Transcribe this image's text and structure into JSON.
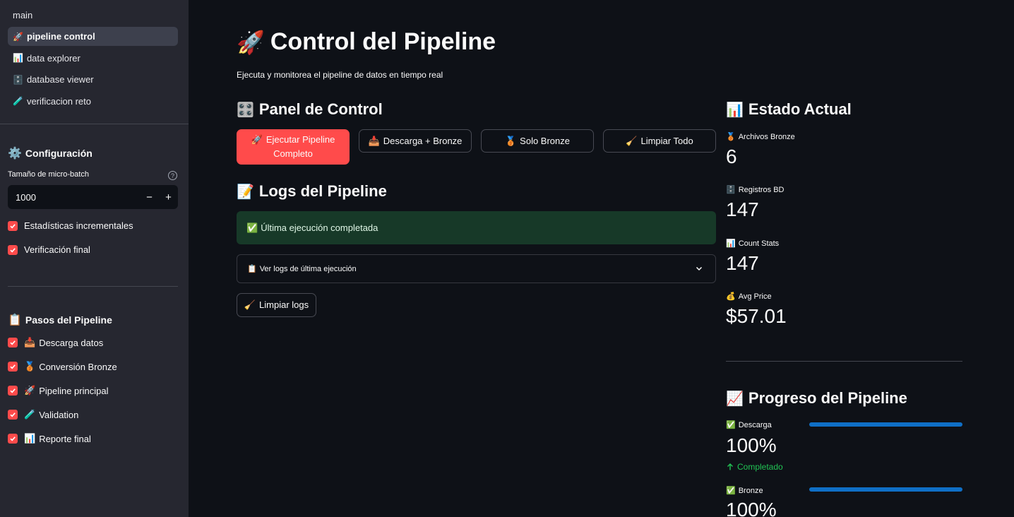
{
  "sidebar": {
    "nav": [
      {
        "icon": "",
        "label": "main"
      },
      {
        "icon": "🚀",
        "label": "pipeline control"
      },
      {
        "icon": "📊",
        "label": "data explorer"
      },
      {
        "icon": "🗄️",
        "label": "database viewer"
      },
      {
        "icon": "🧪",
        "label": "verificacion reto"
      }
    ],
    "config": {
      "icon": "⚙️",
      "title": "Configuración",
      "batch_label": "Tamaño de micro-batch",
      "batch_value": "1000",
      "help_icon": "?",
      "minus": "−",
      "plus": "+",
      "checkboxes": [
        {
          "label": "Estadísticas incrementales",
          "checked": true
        },
        {
          "label": "Verificación final",
          "checked": true
        }
      ]
    },
    "steps": {
      "icon": "📋",
      "title": "Pasos del Pipeline",
      "items": [
        {
          "icon": "📥",
          "label": "Descarga datos",
          "checked": true
        },
        {
          "icon": "🥉",
          "label": "Conversión Bronze",
          "checked": true
        },
        {
          "icon": "🚀",
          "label": "Pipeline principal",
          "checked": true
        },
        {
          "icon": "🧪",
          "label": "Validation",
          "checked": true
        },
        {
          "icon": "📊",
          "label": "Reporte final",
          "checked": true
        }
      ]
    }
  },
  "main": {
    "title_icon": "🚀",
    "title": "Control del Pipeline",
    "subtitle": "Ejecuta y monitorea el pipeline de datos en tiempo real",
    "control_panel": {
      "icon": "🎛️",
      "title": "Panel de Control",
      "buttons": [
        {
          "icon": "🚀",
          "label": "Ejecutar Pipeline Completo"
        },
        {
          "icon": "📥",
          "label": "Descarga + Bronze"
        },
        {
          "icon": "🥉",
          "label": "Solo Bronze"
        },
        {
          "icon": "🧹",
          "label": "Limpiar Todo"
        }
      ]
    },
    "logs": {
      "icon": "📝",
      "title": "Logs del Pipeline",
      "status_icon": "✅",
      "status": "Última ejecución completada",
      "expander_icon": "📋",
      "expander": "Ver logs de última ejecución",
      "clear_icon": "🧹",
      "clear": "Limpiar logs"
    },
    "state": {
      "icon": "📊",
      "title": "Estado Actual",
      "metrics": [
        {
          "icon": "🥉",
          "label": "Archivos Bronze",
          "value": "6"
        },
        {
          "icon": "🗄️",
          "label": "Registros BD",
          "value": "147"
        },
        {
          "icon": "📊",
          "label": "Count Stats",
          "value": "147"
        },
        {
          "icon": "💰",
          "label": "Avg Price",
          "value": "$57.01"
        }
      ]
    },
    "progress": {
      "icon": "📈",
      "title": "Progreso del Pipeline",
      "items": [
        {
          "icon": "✅",
          "label": "Descarga",
          "value": "100%",
          "fraction": 1.0,
          "delta": "Completado"
        },
        {
          "icon": "✅",
          "label": "Bronze",
          "value": "100%",
          "fraction": 1.0
        }
      ]
    }
  },
  "colors": {
    "primary": "#ff4b4b",
    "progress": "#0f6fc6",
    "success_bg": "#173928",
    "delta": "#21c354"
  }
}
